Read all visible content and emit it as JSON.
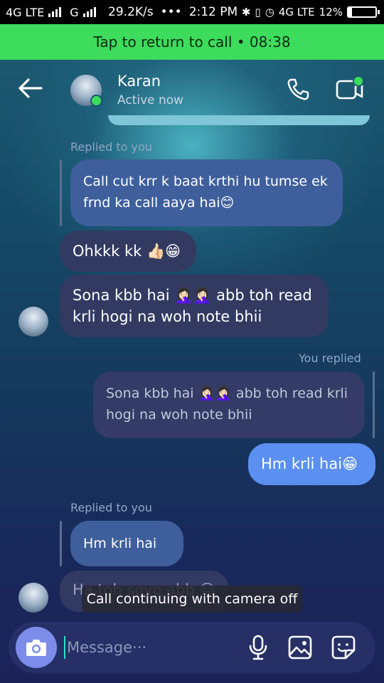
{
  "status_bar": {
    "network1": "4G LTE",
    "network2": "G",
    "speed": "29.2K/s",
    "dots": "•••",
    "time": "2:12 PM",
    "network3": "4G LTE",
    "battery": "12%"
  },
  "call_banner": {
    "text": "Tap to return to call • 08:38"
  },
  "header": {
    "contact_name": "Karan",
    "status": "Active now"
  },
  "messages": {
    "reply_label_1": "Replied to you",
    "quoted_1_line1": "Call cut krr k baat krthi hu tumse ek",
    "quoted_1_line2": "frnd ka call aaya hai😊",
    "incoming_1": "Ohkkk kk 👍🏻😁",
    "incoming_2_line1": "Sona kbb hai 🤦🏻‍♀️🤦🏻‍♀️ abb toh read",
    "incoming_2_line2": "krli hogi na woh note bhii",
    "you_replied_label": "You replied",
    "quoted_out_line1": "Sona kbb hai 🤦🏻‍♀️🤦🏻‍♀️ abb toh read krli",
    "quoted_out_line2": "hogi na woh note bhii",
    "outgoing_1": "Hm krli hai😁",
    "reply_label_2": "Replied to you",
    "quoted_2": "Hm krli hai😁",
    "incoming_3": "Ha toh soyo abb 😑"
  },
  "toast": {
    "text": "Call continuing with camera off"
  },
  "composer": {
    "placeholder": "Message···"
  },
  "colors": {
    "call_banner": "#3ddc5c",
    "outgoing_bubble": "#5b8ff0",
    "incoming_bubble": "#323a62",
    "online_dot": "#3ddc5c"
  },
  "icons": [
    "back-arrow-icon",
    "phone-icon",
    "video-call-icon",
    "camera-icon",
    "mic-icon",
    "gallery-icon",
    "sticker-icon"
  ]
}
